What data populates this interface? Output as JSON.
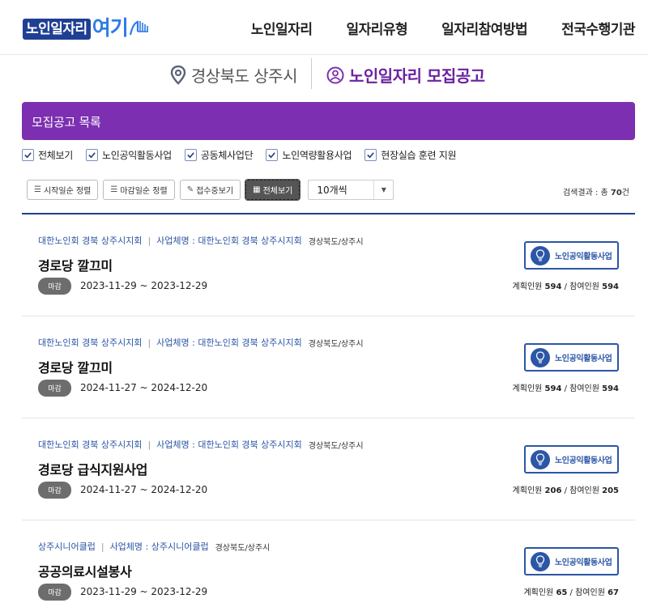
{
  "header": {
    "logo_text1": "노인일자리",
    "logo_text2": "여기",
    "nav": [
      "노인일자리",
      "일자리유형",
      "일자리참여방법",
      "전국수행기관"
    ]
  },
  "location": {
    "region": "경상북도 상주시",
    "section": "노인일자리 모집공고"
  },
  "list": {
    "title": "모집공고 목록",
    "filters": [
      {
        "label": "전체보기",
        "checked": true
      },
      {
        "label": "노인공익활동사업",
        "checked": true
      },
      {
        "label": "공동체사업단",
        "checked": true
      },
      {
        "label": "노인역량활용사업",
        "checked": true
      },
      {
        "label": "현장실습 훈련 지원",
        "checked": true
      }
    ],
    "toolbar": {
      "sort_start": "시작일순 정렬",
      "sort_end": "마감일순 정렬",
      "receiving": "접수중보기",
      "view_all": "전체보기",
      "page_size": "10개씩"
    },
    "result": {
      "prefix": "검색결과 : 총 ",
      "count": "70",
      "suffix": "건"
    }
  },
  "cards": [
    {
      "org": "대한노인회 경북 상주시지회",
      "sep": "|",
      "business": "사업체명 : 대한노인회 경북 상주시지회",
      "region": "경상북도/상주시",
      "title": "경로당 깔끄미",
      "status": "마감",
      "period": "2023-11-29 ~ 2023-12-29",
      "badge": "노인공익활동사업",
      "plan_label": "계획인원 ",
      "plan": "594",
      "slash": " / ",
      "join_label": "참여인원 ",
      "join": "594"
    },
    {
      "org": "대한노인회 경북 상주시지회",
      "sep": "|",
      "business": "사업체명 : 대한노인회 경북 상주시지회",
      "region": "경상북도/상주시",
      "title": "경로당 깔끄미",
      "status": "마감",
      "period": "2024-11-27 ~ 2024-12-20",
      "badge": "노인공익활동사업",
      "plan_label": "계획인원 ",
      "plan": "594",
      "slash": " / ",
      "join_label": "참여인원 ",
      "join": "594"
    },
    {
      "org": "대한노인회 경북 상주시지회",
      "sep": "|",
      "business": "사업체명 : 대한노인회 경북 상주시지회",
      "region": "경상북도/상주시",
      "title": "경로당 급식지원사업",
      "status": "마감",
      "period": "2024-11-27 ~ 2024-12-20",
      "badge": "노인공익활동사업",
      "plan_label": "계획인원 ",
      "plan": "206",
      "slash": " / ",
      "join_label": "참여인원 ",
      "join": "205"
    },
    {
      "org": "상주시니어클럽",
      "sep": "|",
      "business": "사업체명 : 상주시니어클럽",
      "region": "경상북도/상주시",
      "title": "공공의료시설봉사",
      "status": "마감",
      "period": "2023-11-29 ~ 2023-12-29",
      "badge": "노인공익활동사업",
      "plan_label": "계획인원 ",
      "plan": "65",
      "slash": " / ",
      "join_label": "참여인원 ",
      "join": "67"
    }
  ],
  "colors": {
    "brand_navy": "#1f3f94",
    "brand_purple": "#7c2fb0",
    "link_blue": "#2c56a6",
    "status_gray": "#6d6d6d"
  }
}
